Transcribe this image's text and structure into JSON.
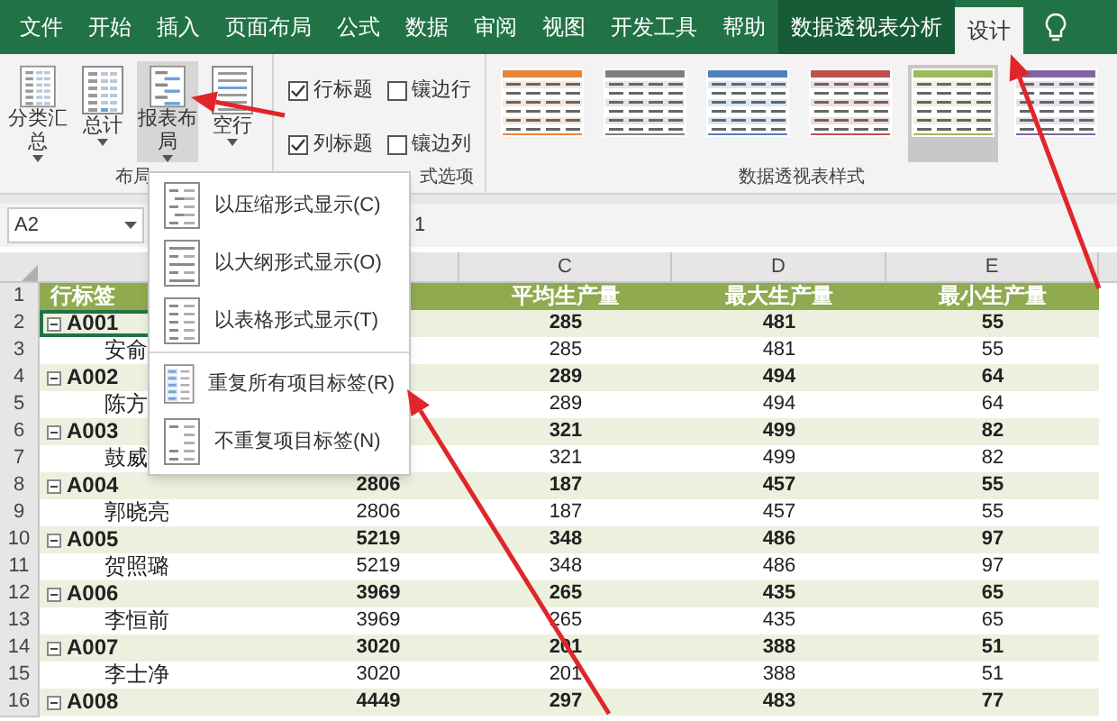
{
  "tabs": [
    {
      "label": "文件",
      "selected": false,
      "kind": "plain"
    },
    {
      "label": "开始",
      "selected": false,
      "kind": "plain"
    },
    {
      "label": "插入",
      "selected": false,
      "kind": "plain"
    },
    {
      "label": "页面布局",
      "selected": false,
      "kind": "plain"
    },
    {
      "label": "公式",
      "selected": false,
      "kind": "plain"
    },
    {
      "label": "数据",
      "selected": false,
      "kind": "plain"
    },
    {
      "label": "审阅",
      "selected": false,
      "kind": "plain"
    },
    {
      "label": "视图",
      "selected": false,
      "kind": "plain"
    },
    {
      "label": "开发工具",
      "selected": false,
      "kind": "plain"
    },
    {
      "label": "帮助",
      "selected": false,
      "kind": "plain"
    },
    {
      "label": "数据透视表分析",
      "selected": false,
      "kind": "context"
    },
    {
      "label": "设计",
      "selected": true,
      "kind": "context"
    }
  ],
  "ribbon": {
    "layout_buttons": [
      {
        "label": "分类汇总",
        "pressed": false,
        "kind": "subtotal"
      },
      {
        "label": "总计",
        "pressed": false,
        "kind": "total"
      },
      {
        "label": "报表布局",
        "pressed": true,
        "kind": "layout"
      },
      {
        "label": "空行",
        "pressed": false,
        "kind": "blank"
      }
    ],
    "layout_group_label": "布局",
    "options": [
      {
        "label": "行标题",
        "checked": true
      },
      {
        "label": "镶边行",
        "checked": false
      },
      {
        "label": "列标题",
        "checked": true
      },
      {
        "label": "镶边列",
        "checked": false
      }
    ],
    "options_group_label": "式选项",
    "styles": [
      {
        "color": "#e8843a",
        "selected": false
      },
      {
        "color": "#7f7f7f",
        "selected": false
      },
      {
        "color": "#4f81bd",
        "selected": false
      },
      {
        "color": "#c0504d",
        "selected": false
      },
      {
        "color": "#9bbb59",
        "selected": true
      },
      {
        "color": "#8064a2",
        "selected": false
      }
    ],
    "styles_group_label": "数据透视表样式"
  },
  "formula_bar": {
    "name_box": "A2",
    "formula": "1"
  },
  "sheet": {
    "column_headers": [
      "C",
      "D",
      "E"
    ],
    "header_row": {
      "row_number": "1",
      "label": "行标签",
      "c": "平均生产量",
      "d": "最大生产量",
      "e": "最小生产量"
    },
    "rows": [
      {
        "row_number": "2",
        "kind": "group",
        "expanded": true,
        "selected": true,
        "label": "A001",
        "c": "285",
        "d": "481",
        "e": "55"
      },
      {
        "row_number": "3",
        "kind": "detail",
        "selected": false,
        "label": "安俞",
        "c": "285",
        "d": "481",
        "e": "55"
      },
      {
        "row_number": "4",
        "kind": "group",
        "expanded": true,
        "selected": false,
        "label": "A002",
        "c": "289",
        "d": "494",
        "e": "64"
      },
      {
        "row_number": "5",
        "kind": "detail",
        "selected": false,
        "label": "陈方",
        "c": "289",
        "d": "494",
        "e": "64"
      },
      {
        "row_number": "6",
        "kind": "group",
        "expanded": true,
        "selected": false,
        "label": "A003",
        "c": "321",
        "d": "499",
        "e": "82"
      },
      {
        "row_number": "7",
        "kind": "detail",
        "selected": false,
        "label": "鼓威",
        "c": "321",
        "d": "499",
        "e": "82"
      },
      {
        "row_number": "8",
        "kind": "group",
        "expanded": true,
        "selected": false,
        "label": "A004",
        "b": "2806",
        "c": "187",
        "d": "457",
        "e": "55"
      },
      {
        "row_number": "9",
        "kind": "detail",
        "selected": false,
        "label": "郭晓亮",
        "b": "2806",
        "c": "187",
        "d": "457",
        "e": "55"
      },
      {
        "row_number": "10",
        "kind": "group",
        "expanded": true,
        "selected": false,
        "label": "A005",
        "b": "5219",
        "c": "348",
        "d": "486",
        "e": "97"
      },
      {
        "row_number": "11",
        "kind": "detail",
        "selected": false,
        "label": "贺照璐",
        "b": "5219",
        "c": "348",
        "d": "486",
        "e": "97"
      },
      {
        "row_number": "12",
        "kind": "group",
        "expanded": true,
        "selected": false,
        "label": "A006",
        "b": "3969",
        "c": "265",
        "d": "435",
        "e": "65"
      },
      {
        "row_number": "13",
        "kind": "detail",
        "selected": false,
        "label": "李恒前",
        "b": "3969",
        "c": "265",
        "d": "435",
        "e": "65"
      },
      {
        "row_number": "14",
        "kind": "group",
        "expanded": true,
        "selected": false,
        "label": "A007",
        "b": "3020",
        "c": "201",
        "d": "388",
        "e": "51"
      },
      {
        "row_number": "15",
        "kind": "detail",
        "selected": false,
        "label": "李士净",
        "b": "3020",
        "c": "201",
        "d": "388",
        "e": "51"
      },
      {
        "row_number": "16",
        "kind": "group",
        "expanded": true,
        "selected": false,
        "label": "A008",
        "b": "4449",
        "c": "297",
        "d": "483",
        "e": "77"
      }
    ]
  },
  "menu": {
    "items": [
      {
        "label": "以压缩形式显示(C)",
        "kind": "compact"
      },
      {
        "label": "以大纲形式显示(O)",
        "kind": "outline"
      },
      {
        "label": "以表格形式显示(T)",
        "kind": "tabular"
      },
      {
        "label": "重复所有项目标签(R)",
        "kind": "repeat"
      },
      {
        "label": "不重复项目标签(N)",
        "kind": "norepeat"
      }
    ]
  }
}
